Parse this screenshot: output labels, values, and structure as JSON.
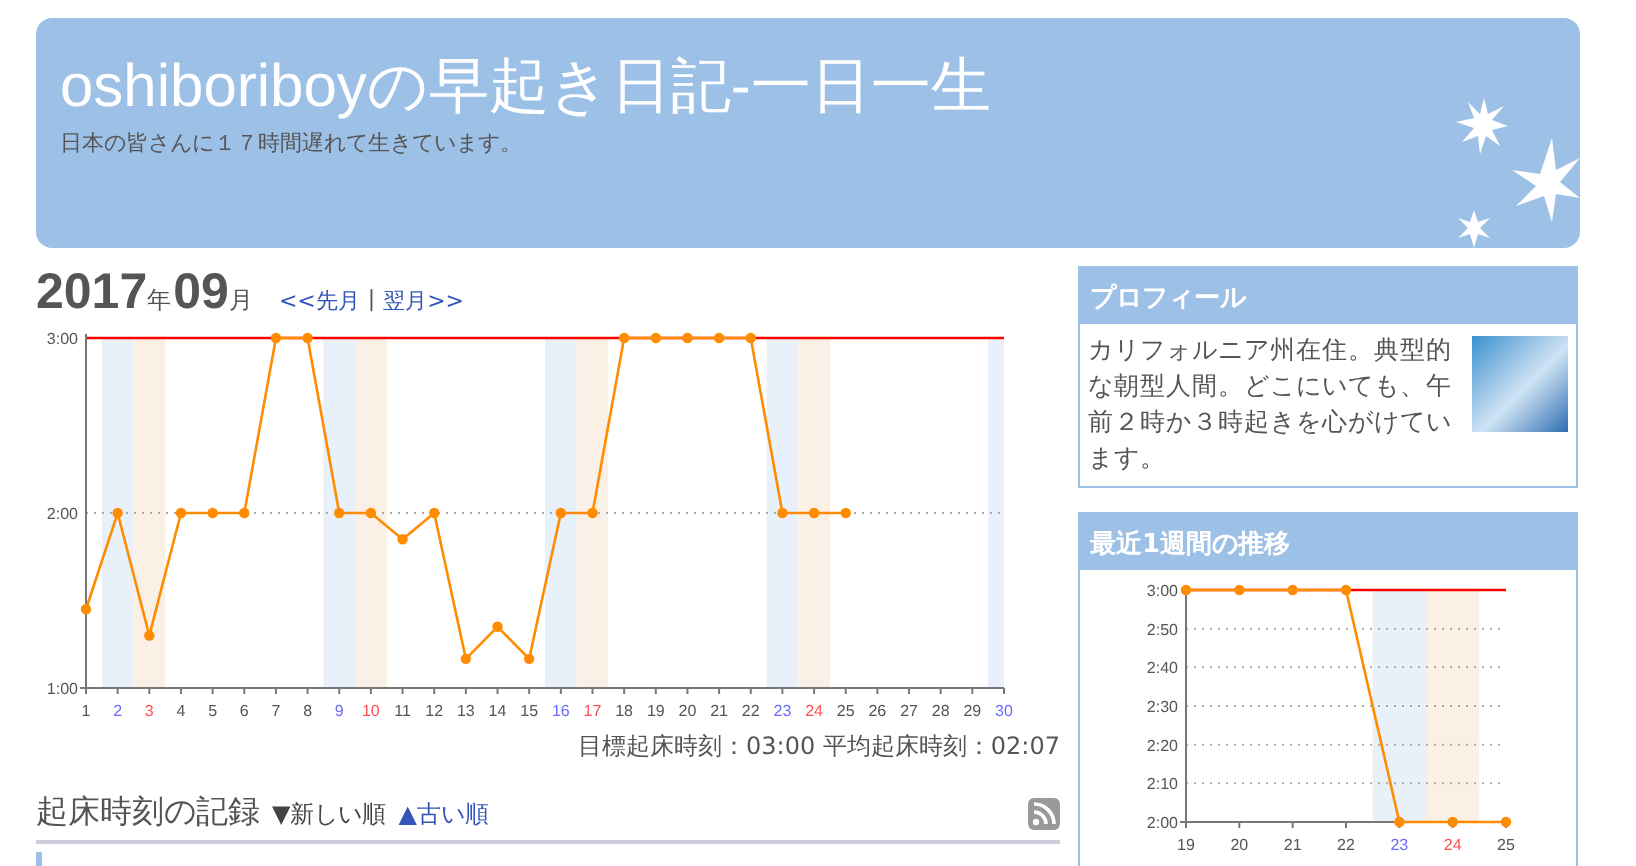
{
  "header": {
    "title": "oshiboriboyの早起き日記-一日一生",
    "subtitle": "日本の皆さんに１７時間遅れて生きています。"
  },
  "month": {
    "year": "2017",
    "year_unit": "年",
    "month": "09",
    "month_unit": "月",
    "prev_link": "<<先月",
    "separator": "|",
    "next_link": "翌月>>"
  },
  "main_chart": {
    "chart_data": {
      "type": "line",
      "x": [
        1,
        2,
        3,
        4,
        5,
        6,
        7,
        8,
        9,
        10,
        11,
        12,
        13,
        14,
        15,
        16,
        17,
        18,
        19,
        20,
        21,
        22,
        23,
        24,
        25
      ],
      "series": [
        {
          "color": "#ff8c00",
          "marker": "circle",
          "values": [
            87,
            120,
            78,
            120,
            120,
            120,
            180,
            180,
            120,
            120,
            111,
            120,
            70,
            81,
            70,
            120,
            120,
            180,
            180,
            180,
            180,
            180,
            120,
            120,
            120
          ]
        }
      ],
      "xlim": [
        1,
        30
      ],
      "xticks": [
        1,
        2,
        3,
        4,
        5,
        6,
        7,
        8,
        9,
        10,
        11,
        12,
        13,
        14,
        15,
        16,
        17,
        18,
        19,
        20,
        21,
        22,
        23,
        24,
        25,
        26,
        27,
        28,
        29,
        30
      ],
      "ylim": [
        60,
        180
      ],
      "yticks": [
        {
          "value": 60,
          "label": "1:00"
        },
        {
          "value": 120,
          "label": "2:00"
        },
        {
          "value": 180,
          "label": "3:00"
        }
      ],
      "grid": true,
      "ref_lines": [
        {
          "axis": "y",
          "value": 180,
          "color": "#ff0000"
        }
      ],
      "bands": [
        {
          "axis": "x",
          "from": 1.5,
          "to": 2.5,
          "color": "#e8f0fa"
        },
        {
          "axis": "x",
          "from": 2.5,
          "to": 3.5,
          "color": "#faf0e6"
        },
        {
          "axis": "x",
          "from": 8.5,
          "to": 9.5,
          "color": "#e8f0fa"
        },
        {
          "axis": "x",
          "from": 9.5,
          "to": 10.5,
          "color": "#faf0e6"
        },
        {
          "axis": "x",
          "from": 15.5,
          "to": 16.5,
          "color": "#e8f0fa"
        },
        {
          "axis": "x",
          "from": 16.5,
          "to": 17.5,
          "color": "#faf0e6"
        },
        {
          "axis": "x",
          "from": 22.5,
          "to": 23.5,
          "color": "#e8f0fa"
        },
        {
          "axis": "x",
          "from": 23.5,
          "to": 24.5,
          "color": "#faf0e6"
        },
        {
          "axis": "x",
          "from": 29.5,
          "to": 30,
          "color": "#e8f0fa"
        }
      ]
    }
  },
  "summary": "目標起床時刻：03:00 平均起床時刻：02:07",
  "records": {
    "title": "起床時刻の記録",
    "newest_link": "▼新しい順",
    "oldest_link": "▲古い順"
  },
  "profile": {
    "title": "プロフィール",
    "text": "カリフォルニア州在住。典型的な朝型人間。どこにいても、午前２時か３時起きを心がけています。"
  },
  "weekly": {
    "title": "最近1週間の推移",
    "chart_data": {
      "type": "line",
      "x": [
        19,
        20,
        21,
        22,
        23,
        24,
        25
      ],
      "series": [
        {
          "color": "#ff8c00",
          "marker": "circle",
          "values": [
            180,
            180,
            180,
            180,
            120,
            120,
            120
          ]
        }
      ],
      "xlim": [
        19,
        25
      ],
      "xticks": [
        19,
        20,
        21,
        22,
        23,
        24,
        25
      ],
      "ylim": [
        120,
        180
      ],
      "yticks": [
        {
          "value": 120,
          "label": "2:00"
        },
        {
          "value": 130,
          "label": "2:10"
        },
        {
          "value": 140,
          "label": "2:20"
        },
        {
          "value": 150,
          "label": "2:30"
        },
        {
          "value": 160,
          "label": "2:40"
        },
        {
          "value": 170,
          "label": "2:50"
        },
        {
          "value": 180,
          "label": "3:00"
        }
      ],
      "grid": true,
      "ref_lines": [
        {
          "axis": "y",
          "value": 180,
          "color": "#ff0000"
        }
      ],
      "bands": [
        {
          "axis": "x",
          "from": 22.5,
          "to": 23.5,
          "color": "#e8f0fa"
        },
        {
          "axis": "x",
          "from": 23.5,
          "to": 24.5,
          "color": "#faf0e6"
        }
      ]
    }
  }
}
